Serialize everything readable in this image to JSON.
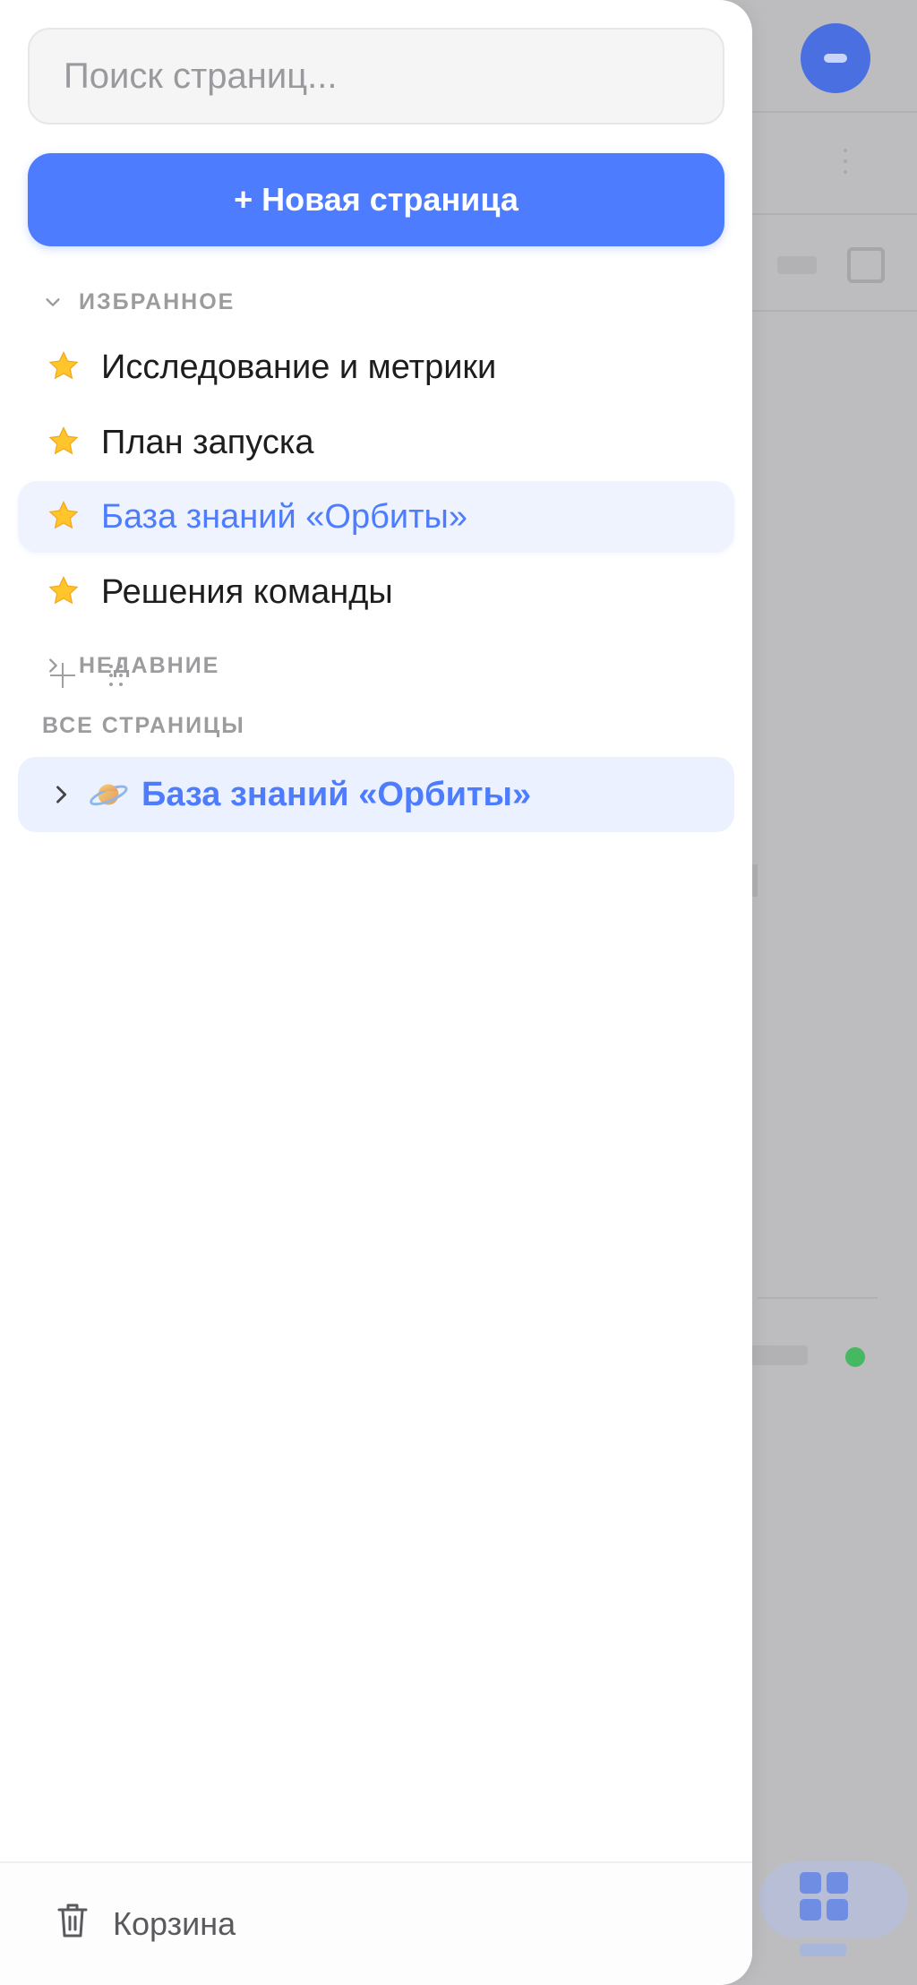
{
  "search": {
    "placeholder": "Поиск страниц..."
  },
  "new_page_label": "+ Новая страница",
  "favorites": {
    "title": "ИЗБРАННОЕ",
    "items": [
      {
        "label": "Исследование и метрики",
        "active": false
      },
      {
        "label": "План запуска",
        "active": false
      },
      {
        "label": "База знаний «Орбиты»",
        "active": true
      },
      {
        "label": "Решения команды",
        "active": false
      }
    ]
  },
  "recent": {
    "title": "НЕДАВНИЕ"
  },
  "all_pages": {
    "title": "ВСЕ СТРАНИЦЫ",
    "items": [
      {
        "label": "База знаний «Орбиты»",
        "icon": "planet-icon"
      }
    ]
  },
  "footer": {
    "trash_label": "Корзина"
  },
  "colors": {
    "accent": "#4d7cfe",
    "active_bg": "#eef3fe",
    "status_green": "#45b861"
  }
}
